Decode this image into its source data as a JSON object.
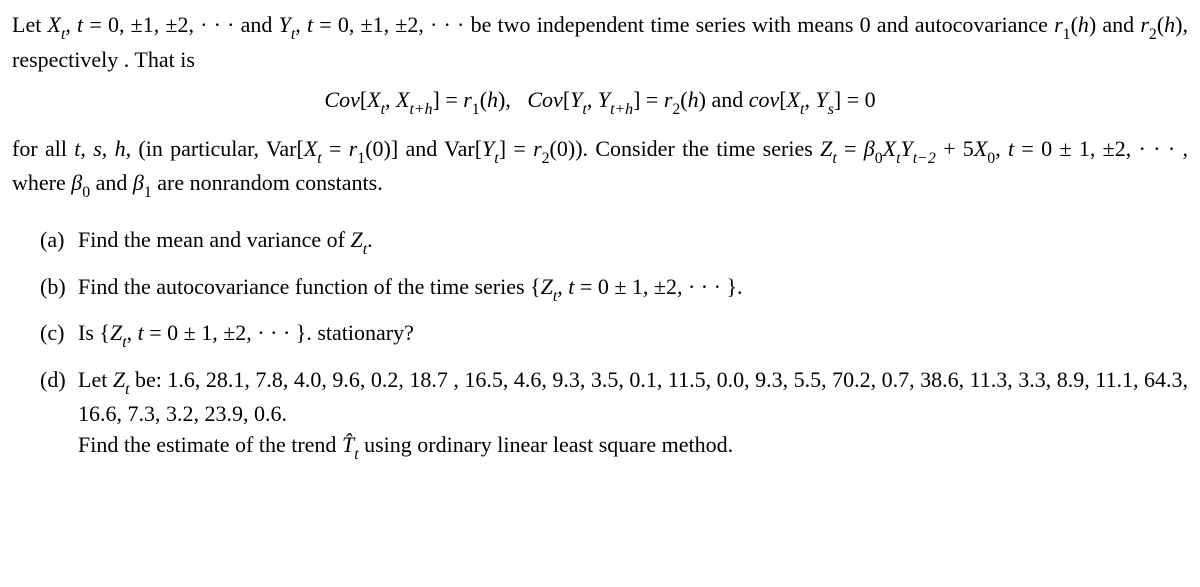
{
  "intro": {
    "line1": "Let Xₜ, t = 0, ±1, ±2, · · · and Yₜ, t = 0, ±1, ±2, · · · be two independent time series with means 0 and autocovariance r₁(h) and r₂(h), respectively . That is",
    "math_line": "Cov[Xₜ, Xₜ₊ₕ] = r₁(h),   Cov[Yₜ, Yₜ₊ₕ] = r₂(h) and cov[Xₜ, Yₛ] = 0",
    "line2": "for all t, s, h, (in particular, Var[Xₜ = r₁(0)] and Var[Yₜ] = r₂(0)). Consider the time series Zₜ = β₀XₜYₜ₋₂ + 5X₀, t = 0 ± 1, ±2, · · · , where β₀ and β₁ are nonrandom constants."
  },
  "items": {
    "a": {
      "marker": "(a)",
      "text": "Find the mean and variance of Zₜ."
    },
    "b": {
      "marker": "(b)",
      "text": "Find the autocovariance function of the time series {Zₜ, t = 0 ± 1, ±2, · · · }."
    },
    "c": {
      "marker": "(c)",
      "text": "Is {Zₜ, t = 0 ± 1, ±2, · · · }. stationary?"
    },
    "d": {
      "marker": "(d)",
      "line1": "Let Zₜ be: 1.6, 28.1, 7.8, 4.0, 9.6, 0.2, 18.7 , 16.5, 4.6, 9.3, 3.5, 0.1, 11.5, 0.0, 9.3, 5.5, 70.2, 0.7, 38.6, 11.3, 3.3, 8.9, 11.1, 64.3, 16.6, 7.3, 3.2, 23.9, 0.6.",
      "line2": "Find the estimate of the trend T̂ₜ using ordinary linear least square method."
    }
  }
}
